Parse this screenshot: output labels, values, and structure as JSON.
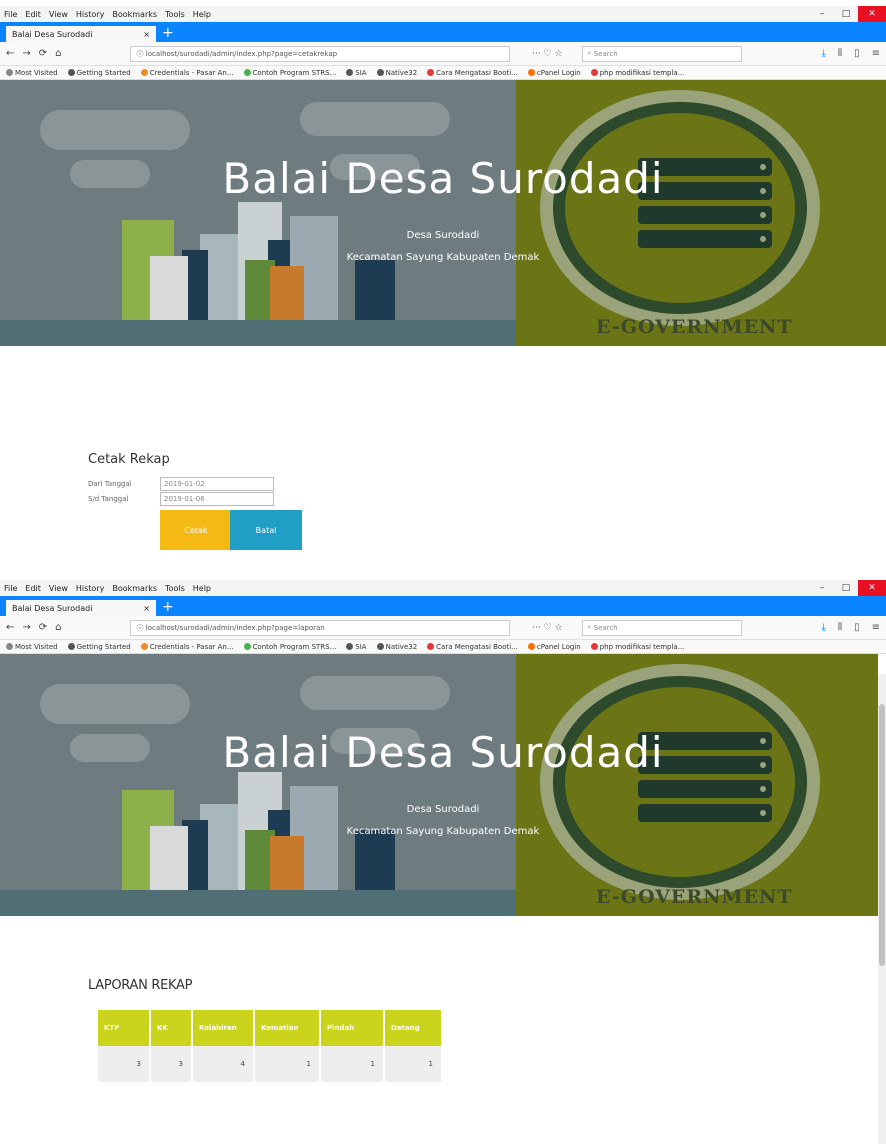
{
  "browser": {
    "menu": [
      "File",
      "Edit",
      "View",
      "History",
      "Bookmarks",
      "Tools",
      "Help"
    ],
    "tab_title": "Balai Desa Surodadi",
    "tab_close": "×",
    "new_tab": "+",
    "url_top": "localhost/surodadi/admin/index.php?page=cetakrekap",
    "url_bottom": "localhost/surodadi/admin/index.php?page=laporan",
    "url_actions": "··· ♡ ☆",
    "search_placeholder": "Search",
    "bookmarks": [
      {
        "label": "Most Visited",
        "color": "#888888"
      },
      {
        "label": "Getting Started",
        "color": "#555555"
      },
      {
        "label": "Credentials - Pasar An...",
        "color": "#f08a24"
      },
      {
        "label": "Contoh Program STRS...",
        "color": "#4caf50"
      },
      {
        "label": "SIA",
        "color": "#555555"
      },
      {
        "label": "Native32",
        "color": "#555555"
      },
      {
        "label": "Cara Mengatasi Booti...",
        "color": "#e53935"
      },
      {
        "label": "cPanel Login",
        "color": "#ff6f00"
      },
      {
        "label": "php modifikasi templa...",
        "color": "#e53935"
      }
    ]
  },
  "hero": {
    "title": "Balai Desa Surodadi",
    "line1": "Desa Surodadi",
    "line2": "Kecamatan Sayung Kabupaten Demak",
    "badge": "E-GOVERNMENT"
  },
  "cetak": {
    "title": "Cetak Rekap",
    "from_label": "Dari Tanggal",
    "from_value": "2019-01-02",
    "to_label": "S/d Tanggal",
    "to_value": "2019-01-06",
    "print_button": "Cetak",
    "cancel_button": "Batal"
  },
  "laporan": {
    "title": "LAPORAN REKAP",
    "headers": [
      "KTP",
      "KK",
      "Kelahiran",
      "Kematian",
      "Pindah",
      "Datang"
    ],
    "values": [
      "3",
      "3",
      "4",
      "1",
      "1",
      "1"
    ]
  },
  "colors": {
    "firefox_blue": "#0a84ff",
    "table_header": "#cbd41c",
    "print_button": "#f5b914",
    "cancel_button": "#1f9ec6"
  }
}
